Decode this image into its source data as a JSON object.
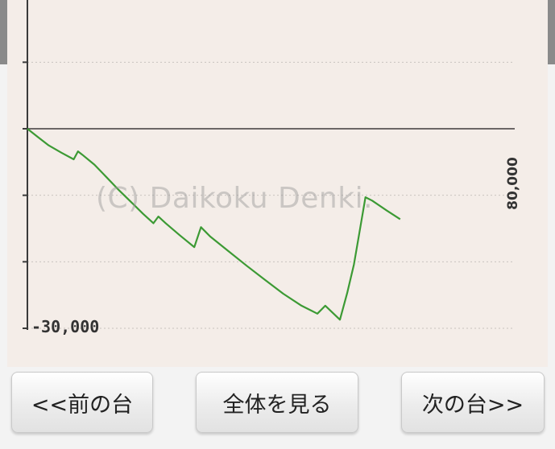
{
  "chart_data": {
    "type": "line",
    "title": "",
    "xlabel": "",
    "ylabel": "",
    "y_axis_labels": [
      "-30,000"
    ],
    "x_axis_labels": [
      "80,000"
    ],
    "watermark": "(C) Daikoku Denki.",
    "grid": true,
    "ylim": [
      -30000,
      10000
    ],
    "xlim": [
      0,
      80000
    ],
    "series": [
      {
        "color": "#3c9a34",
        "points": [
          [
            0,
            0
          ],
          [
            1800,
            -1300
          ],
          [
            3500,
            -2500
          ],
          [
            5600,
            -3600
          ],
          [
            7600,
            -4600
          ],
          [
            8300,
            -3400
          ],
          [
            9000,
            -3900
          ],
          [
            11000,
            -5400
          ],
          [
            13000,
            -7300
          ],
          [
            15000,
            -9200
          ],
          [
            17000,
            -11000
          ],
          [
            19000,
            -12800
          ],
          [
            20700,
            -14200
          ],
          [
            21500,
            -13200
          ],
          [
            22700,
            -14200
          ],
          [
            25000,
            -16000
          ],
          [
            27400,
            -17800
          ],
          [
            28500,
            -14800
          ],
          [
            30000,
            -16200
          ],
          [
            33000,
            -18400
          ],
          [
            36000,
            -20600
          ],
          [
            39000,
            -22700
          ],
          [
            42000,
            -24800
          ],
          [
            45000,
            -26600
          ],
          [
            47600,
            -27800
          ],
          [
            48900,
            -26600
          ],
          [
            51300,
            -28700
          ],
          [
            52500,
            -24700
          ],
          [
            53600,
            -20400
          ],
          [
            54500,
            -15600
          ],
          [
            55500,
            -10300
          ],
          [
            56600,
            -10800
          ],
          [
            59000,
            -12300
          ],
          [
            61200,
            -13600
          ]
        ]
      }
    ]
  },
  "watermark_text": "(C) Daikoku Denki.",
  "buttons": {
    "prev": "<<前の台",
    "all": "全体を見る",
    "next": "次の台>>"
  }
}
